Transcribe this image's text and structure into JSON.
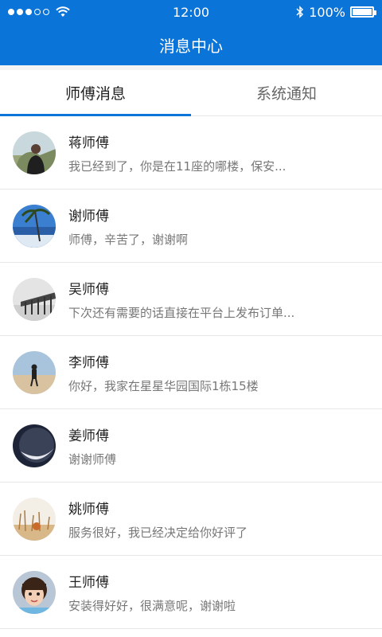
{
  "status_bar": {
    "time": "12:00",
    "battery": "100%",
    "signal_full": 3,
    "signal_total": 5,
    "battery_level": 1.0
  },
  "header": {
    "title": "消息中心"
  },
  "tabs": [
    {
      "label": "师傅消息",
      "active": true
    },
    {
      "label": "系统通知",
      "active": false
    }
  ],
  "messages": [
    {
      "name": "蒋师傅",
      "preview": "我已经到了，你是在11座的哪楼，保安...",
      "avatar": "person-avatar"
    },
    {
      "name": "谢师傅",
      "preview": "师傅，辛苦了，谢谢啊",
      "avatar": "beach-avatar"
    },
    {
      "name": "吴师傅",
      "preview": "下次还有需要的话直接在平台上发布订单...",
      "avatar": "pier-avatar"
    },
    {
      "name": "李师傅",
      "preview": "你好，我家在星星华园国际1栋15楼",
      "avatar": "beach-person-avatar"
    },
    {
      "name": "姜师傅",
      "preview": "谢谢师傅",
      "avatar": "moon-avatar"
    },
    {
      "name": "姚师傅",
      "preview": "服务很好，我已经决定给你好评了",
      "avatar": "field-avatar"
    },
    {
      "name": "王师傅",
      "preview": "安装得好好，很满意呢，谢谢啦",
      "avatar": "child-avatar"
    }
  ],
  "colors": {
    "brand": "#0a74d8",
    "divider": "#e8e8e8"
  }
}
